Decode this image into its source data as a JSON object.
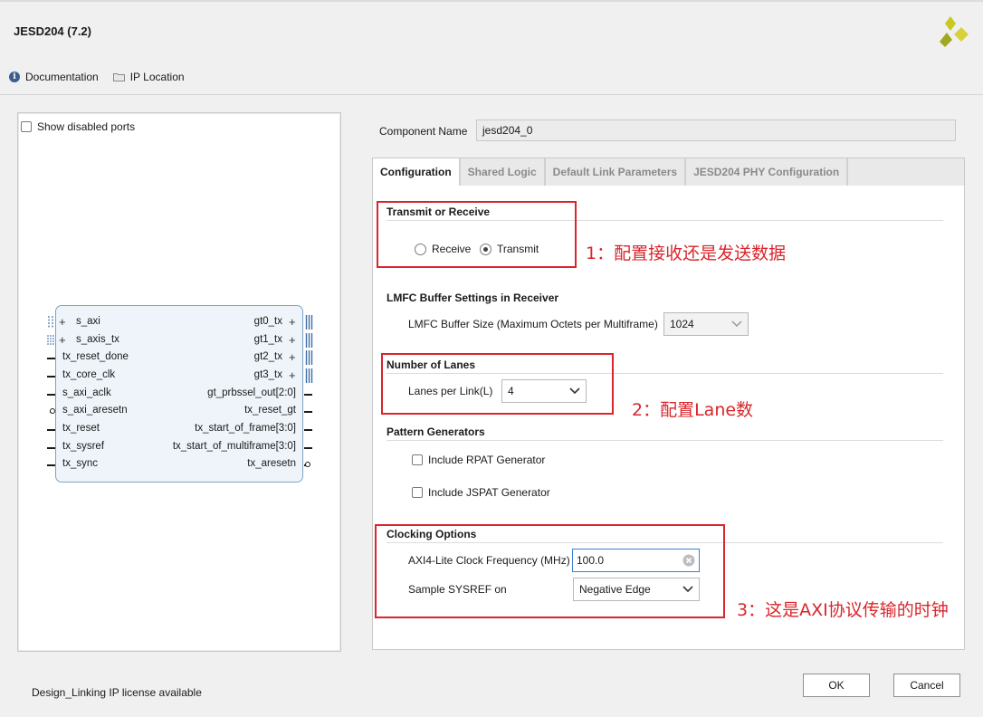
{
  "window": {
    "title": "JESD204 (7.2)"
  },
  "toplinks": {
    "documentation": "Documentation",
    "ip_location": "IP Location"
  },
  "left_panel": {
    "show_disabled_ports": "Show disabled ports",
    "left_ports": [
      "s_axi",
      "s_axis_tx",
      "tx_reset_done",
      "tx_core_clk",
      "s_axi_aclk",
      "s_axi_aresetn",
      "tx_reset",
      "tx_sysref",
      "tx_sync"
    ],
    "right_ports": [
      "gt0_tx",
      "gt1_tx",
      "gt2_tx",
      "gt3_tx",
      "gt_prbssel_out[2:0]",
      "tx_reset_gt",
      "tx_start_of_frame[3:0]",
      "tx_start_of_multiframe[3:0]",
      "tx_aresetn"
    ]
  },
  "component": {
    "label": "Component Name",
    "value": "jesd204_0"
  },
  "tabs": [
    "Configuration",
    "Shared Logic",
    "Default Link Parameters",
    "JESD204 PHY Configuration"
  ],
  "config": {
    "transmit_receive": {
      "title": "Transmit or Receive",
      "receive": "Receive",
      "transmit": "Transmit",
      "selected": "Transmit"
    },
    "lmfc": {
      "title": "LMFC Buffer Settings in Receiver",
      "label": "LMFC Buffer Size (Maximum Octets per Multiframe)",
      "value": "1024"
    },
    "lanes": {
      "title": "Number of Lanes",
      "label": "Lanes per Link(L)",
      "value": "4"
    },
    "pattern": {
      "title": "Pattern Generators",
      "rpat": "Include RPAT Generator",
      "jspat": "Include JSPAT Generator"
    },
    "clocking": {
      "title": "Clocking Options",
      "axi_label": "AXI4-Lite Clock Frequency (MHz)",
      "axi_value": "100.0",
      "sysref_label": "Sample SYSREF on",
      "sysref_value": "Negative Edge"
    }
  },
  "annotations": [
    "1：配置接收还是发送数据",
    "2：配置Lane数",
    "3：这是AXI协议传输的时钟"
  ],
  "footer": {
    "license": "Design_Linking IP license available",
    "ok": "OK",
    "cancel": "Cancel"
  },
  "colors": {
    "annotation_red": "#d9252b",
    "ip_block_fill": "#eef4fa",
    "ip_block_border": "#7ea3c4",
    "logo_yellow": "#c8c81e"
  }
}
